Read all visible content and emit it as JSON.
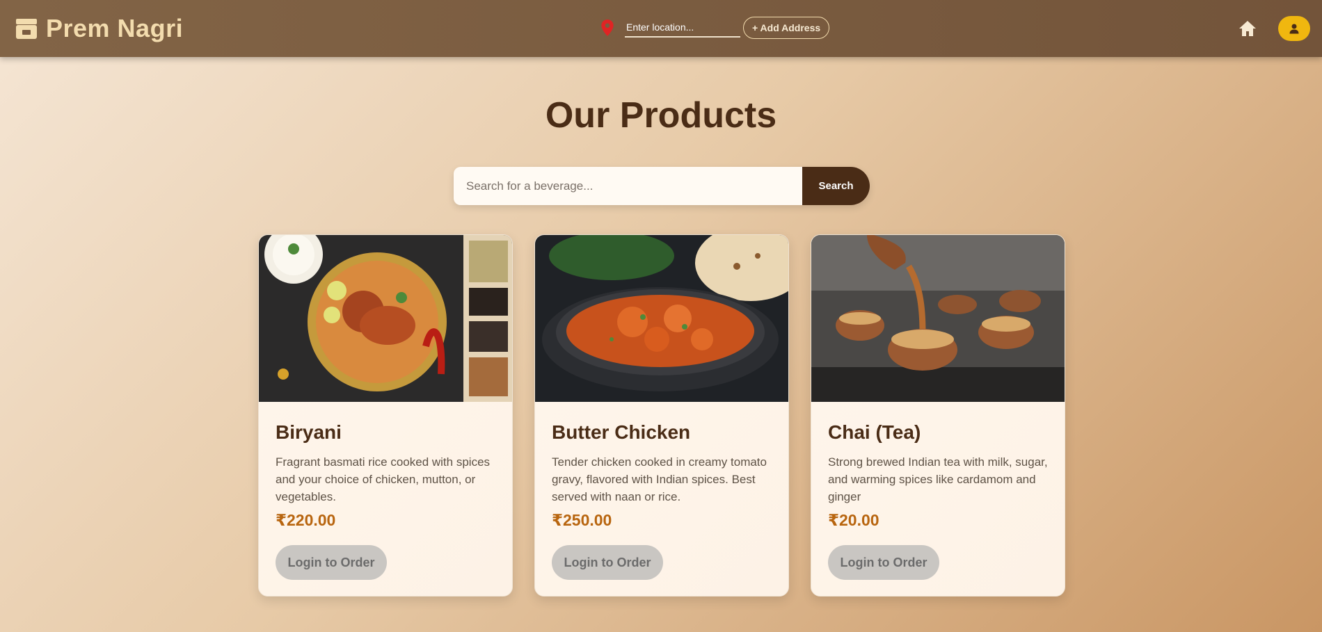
{
  "header": {
    "brand": "Prem Nagri",
    "location_placeholder": "Enter location...",
    "add_address": "+ Add Address"
  },
  "page": {
    "title": "Our Products",
    "search_placeholder": "Search for a beverage...",
    "search_button": "Search"
  },
  "products": [
    {
      "name": "Biryani",
      "description": "Fragrant basmati rice cooked with spices and your choice of chicken, mutton, or vegetables.",
      "price": "₹220.00",
      "button": "Login to Order"
    },
    {
      "name": "Butter Chicken",
      "description": "Tender chicken cooked in creamy tomato gravy, flavored with Indian spices. Best served with naan or rice.",
      "price": "₹250.00",
      "button": "Login to Order"
    },
    {
      "name": "Chai (Tea)",
      "description": "Strong brewed Indian tea with milk, sugar, and warming spices like cardamom and ginger",
      "price": "₹20.00",
      "button": "Login to Order"
    }
  ],
  "colors": {
    "header_bg": "#7b5c40",
    "brand_text": "#f3dcae",
    "title": "#4a2c16",
    "price": "#b8650f",
    "profile_button": "#f0b70f",
    "location_pin": "#e02424"
  },
  "icons": {
    "brand": "store-icon",
    "location": "location-pin-icon",
    "home": "home-icon",
    "profile": "user-icon"
  }
}
